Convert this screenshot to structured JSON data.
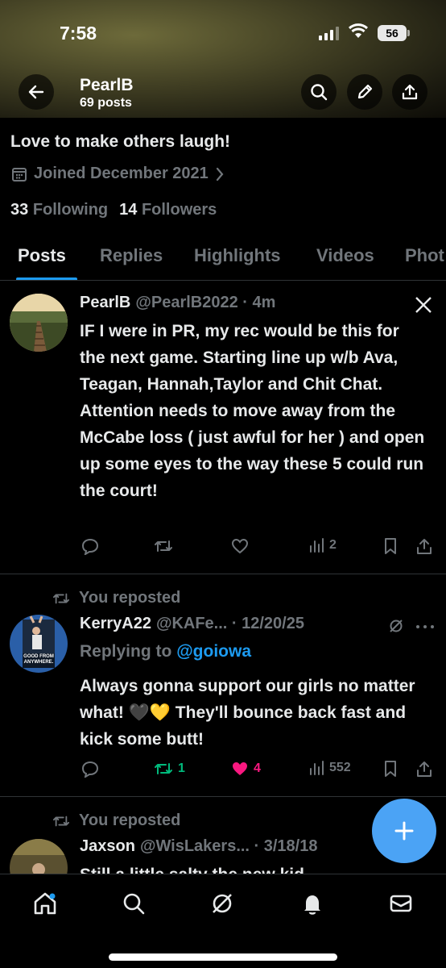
{
  "status_bar": {
    "time": "7:58",
    "battery": "56"
  },
  "header": {
    "name": "PearlB",
    "post_count": "69 posts",
    "icons": [
      "back-arrow-icon",
      "search-icon",
      "pencil-icon",
      "share-icon"
    ]
  },
  "profile": {
    "bio": "Love to make others laugh!",
    "joined": "Joined December 2021",
    "following_count": "33",
    "following_label": "Following",
    "followers_count": "14",
    "followers_label": "Followers"
  },
  "tabs": [
    {
      "label": "Posts",
      "active": true
    },
    {
      "label": "Replies",
      "active": false
    },
    {
      "label": "Highlights",
      "active": false
    },
    {
      "label": "Videos",
      "active": false
    },
    {
      "label": "Phot",
      "active": false
    }
  ],
  "posts": [
    {
      "name": "PearlB",
      "handle": "@PearlB2022 · 4m",
      "text": "IF I were in PR, my rec would be this for the next game. Starting line up w/b Ava, Teagan, Hannah,Taylor and Chit Chat.  Attention needs to move away from the McCabe loss ( just awful for her ) and open up some eyes to the way these 5 could run the court!",
      "views": "2"
    },
    {
      "repost_label": "You reposted",
      "name": "KerryA22",
      "handle": "@KAFe... · 12/20/25",
      "replying_prefix": "Replying to",
      "replying_to": "@goiowa",
      "text": "Always gonna support our girls no matter what! 🖤💛 They'll bounce back fast and kick some butt!",
      "reposts": "1",
      "likes": "4",
      "views": "552",
      "avatar_text": "GOOD FROM ANYWHERE."
    },
    {
      "repost_label": "You reposted",
      "name": "Jaxson",
      "handle": "@WisLakers... · 3/18/18",
      "text": "Still a little salty the new kid"
    }
  ],
  "colors": {
    "accent": "#1d9bf0",
    "muted": "#71767b",
    "text": "#e7e9ea",
    "like": "#f91880",
    "repost": "#00ba7c"
  }
}
